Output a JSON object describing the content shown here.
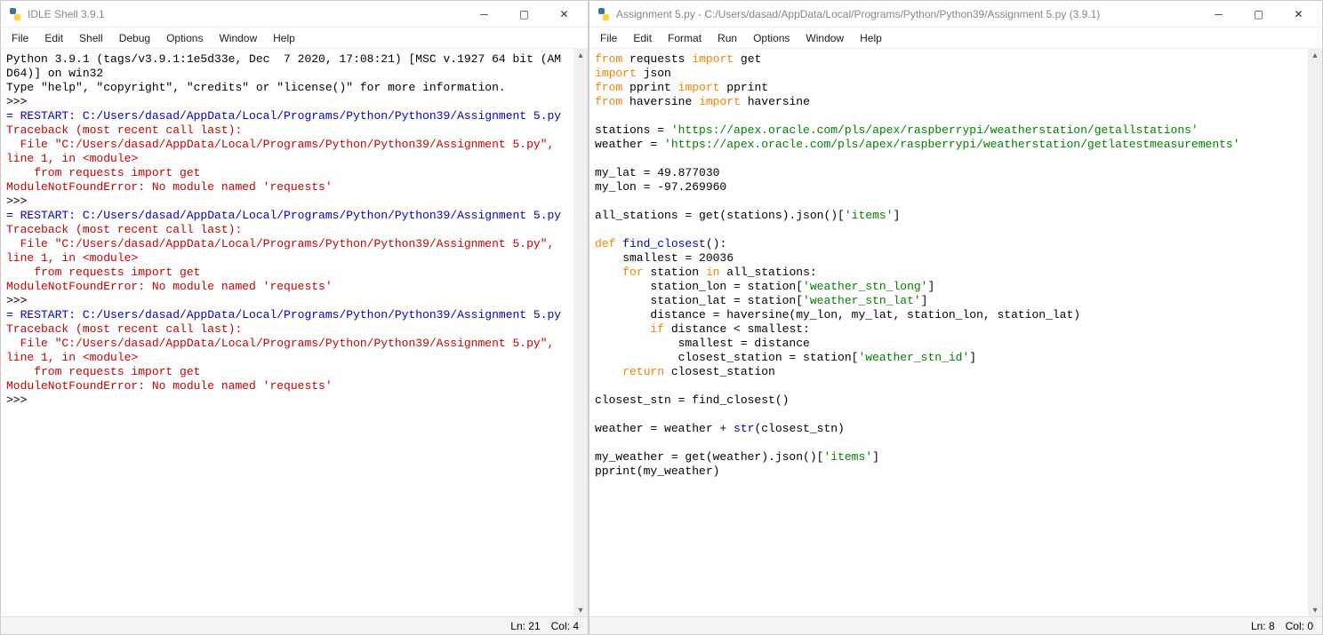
{
  "shell": {
    "title": "IDLE Shell 3.9.1",
    "menus": [
      "File",
      "Edit",
      "Shell",
      "Debug",
      "Options",
      "Window",
      "Help"
    ],
    "status": {
      "ln": "Ln: 21",
      "col": "Col: 4"
    },
    "content": {
      "header1": "Python 3.9.1 (tags/v3.9.1:1e5d33e, Dec  7 2020, 17:08:21) [MSC v.1927 64 bit (AM",
      "header2": "D64)] on win32",
      "header3": "Type \"help\", \"copyright\", \"credits\" or \"license()\" for more information.",
      "prompt": ">>> ",
      "restart": "= RESTART: C:/Users/dasad/AppData/Local/Programs/Python/Python39/Assignment 5.py",
      "tb1": "Traceback (most recent call last):",
      "tb2": "  File \"C:/Users/dasad/AppData/Local/Programs/Python/Python39/Assignment 5.py\",",
      "tb3": "line 1, in <module>",
      "tb4": "    from requests import get",
      "tb5": "ModuleNotFoundError: No module named 'requests'"
    }
  },
  "editor": {
    "title": "Assignment 5.py - C:/Users/dasad/AppData/Local/Programs/Python/Python39/Assignment 5.py (3.9.1)",
    "menus": [
      "File",
      "Edit",
      "Format",
      "Run",
      "Options",
      "Window",
      "Help"
    ],
    "status": {
      "ln": "Ln: 8",
      "col": "Col: 0"
    },
    "tokens": {
      "from": "from",
      "import": "import",
      "requests": "requests",
      "get": "get",
      "json": "json",
      "pprint": "pprint",
      "haversine": "haversine",
      "stations_eq": "stations = ",
      "stations_url": "'https://apex.oracle.com/pls/apex/raspberrypi/weatherstation/getallstations'",
      "weather_eq": "weather = ",
      "weather_url": "'https://apex.oracle.com/pls/apex/raspberrypi/weatherstation/getlatestmeasurements'",
      "mylat": "my_lat = 49.877030",
      "mylon": "my_lon = -97.269960",
      "allstations": "all_stations = get(stations).json()[",
      "items": "'items'",
      "close": "]",
      "def": "def",
      "fname": "find_closest",
      "fargs": "():",
      "smallest_init": "    smallest = 20036",
      "for": "for",
      "in": "in",
      "for_line_pre": "    ",
      "for_var": " station ",
      "for_tail": " all_stations:",
      "stlon_pre": "        station_lon = station[",
      "stlon_key": "'weather_stn_long'",
      "stlat_pre": "        station_lat = station[",
      "stlat_key": "'weather_stn_lat'",
      "dist": "        distance = haversine(my_lon, my_lat, station_lon, station_lat)",
      "if": "if",
      "if_pre": "        ",
      "if_tail": " distance < smallest:",
      "sm_assign": "            smallest = distance",
      "cs_pre": "            closest_station = station[",
      "cs_key": "'weather_stn_id'",
      "return": "return",
      "ret_pre": "    ",
      "ret_tail": " closest_station",
      "closest_stn": "closest_stn = find_closest()",
      "weather_plus_pre": "weather = weather + ",
      "str_builtin": "str",
      "weather_plus_post": "(closest_stn)",
      "myweather_pre": "my_weather = get(weather).json()[",
      "pprint_call": "pprint(my_weather)"
    }
  }
}
